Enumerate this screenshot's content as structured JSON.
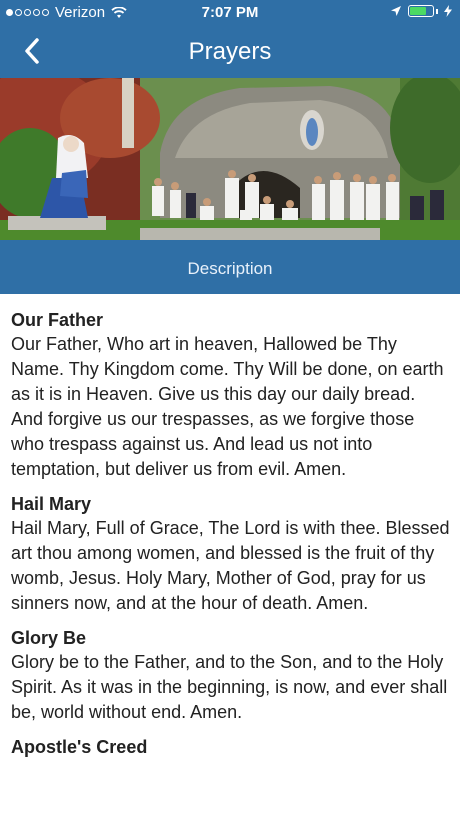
{
  "status": {
    "carrier": "Verizon",
    "time": "7:07 PM",
    "battery_color": "#4cd964"
  },
  "nav": {
    "title": "Prayers",
    "back_icon": "chevron-left-icon"
  },
  "hero": {
    "image": "grotto-photo"
  },
  "description_tab": {
    "label": "Description"
  },
  "prayers": [
    {
      "title": "Our Father",
      "text": "Our Father, Who art in heaven, Hallowed be Thy Name. Thy Kingdom come. Thy Will be done, on earth as it is in Heaven. Give us this day our daily bread. And forgive us our trespasses, as we forgive those who trespass against us. And lead us not into temptation, but deliver us from evil. Amen."
    },
    {
      "title": "Hail Mary",
      "text": "Hail Mary, Full of Grace, The Lord is with thee. Blessed art thou among women, and blessed is the fruit of thy womb, Jesus. Holy Mary, Mother of God, pray for us sinners now, and at the hour of death. Amen."
    },
    {
      "title": "Glory Be",
      "text": "Glory be to the Father, and to the Son, and to the Holy Spirit. As it was in the beginning, is now, and ever shall be, world without end. Amen."
    },
    {
      "title": "Apostle's Creed",
      "text": ""
    }
  ],
  "colors": {
    "header": "#2f6fa6",
    "text": "#222222"
  }
}
